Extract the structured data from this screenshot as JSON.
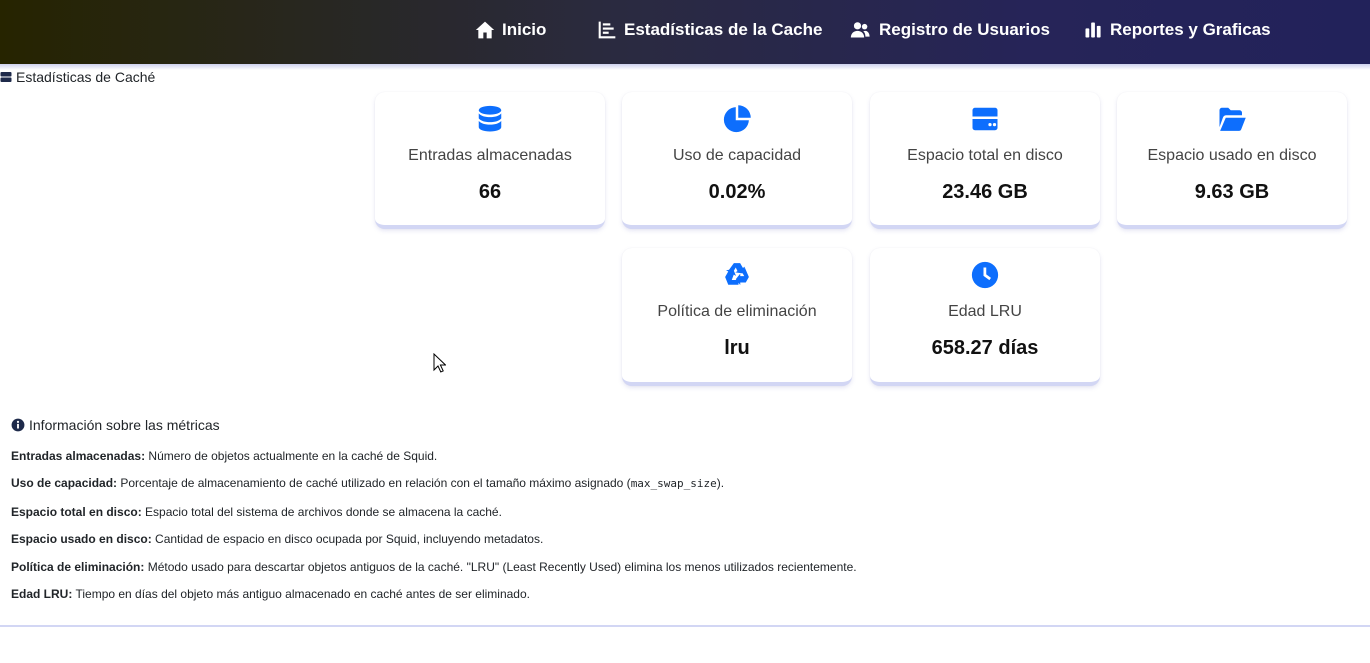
{
  "navbar": {
    "items": [
      {
        "label": "Inicio",
        "icon": "home-icon"
      },
      {
        "label": "Estadísticas de la Cache",
        "icon": "chart-line-icon"
      },
      {
        "label": "Registro de Usuarios",
        "icon": "users-icon"
      },
      {
        "label": "Reportes y Graficas",
        "icon": "bar-chart-icon"
      }
    ]
  },
  "page": {
    "title": "Estadísticas de Caché"
  },
  "cards": [
    {
      "label": "Entradas almacenadas",
      "value": "66",
      "icon": "database-icon"
    },
    {
      "label": "Uso de capacidad",
      "value": "0.02%",
      "icon": "pie-chart-icon"
    },
    {
      "label": "Espacio total en disco",
      "value": "23.46 GB",
      "icon": "hard-drive-icon"
    },
    {
      "label": "Espacio usado en disco",
      "value": "9.63 GB",
      "icon": "folder-open-icon"
    },
    {
      "label": "Política de eliminación",
      "value": "lru",
      "icon": "recycle-icon"
    },
    {
      "label": "Edad LRU",
      "value": "658.27 días",
      "icon": "clock-icon"
    }
  ],
  "info": {
    "title": "Información sobre las métricas",
    "items": [
      {
        "term": "Entradas almacenadas:",
        "desc": "Número de objetos actualmente en la caché de Squid."
      },
      {
        "term": "Uso de capacidad:",
        "desc": "Porcentaje de almacenamiento de caché utilizado en relación con el tamaño máximo asignado (",
        "code": "max_swap_size",
        "tail": ")."
      },
      {
        "term": "Espacio total en disco:",
        "desc": "Espacio total del sistema de archivos donde se almacena la caché."
      },
      {
        "term": "Espacio usado en disco:",
        "desc": "Cantidad de espacio en disco ocupada por Squid, incluyendo metadatos."
      },
      {
        "term": "Política de eliminación:",
        "desc": "Método usado para descartar objetos antiguos de la caché. \"LRU\" (Least Recently Used) elimina los menos utilizados recientemente."
      },
      {
        "term": "Edad LRU:",
        "desc": "Tiempo en días del objeto más antiguo almacenado en caché antes de ser eliminado."
      }
    ]
  },
  "colors": {
    "accent": "#0d6efd",
    "navbar_start": "#262400",
    "navbar_end": "#22225a"
  }
}
